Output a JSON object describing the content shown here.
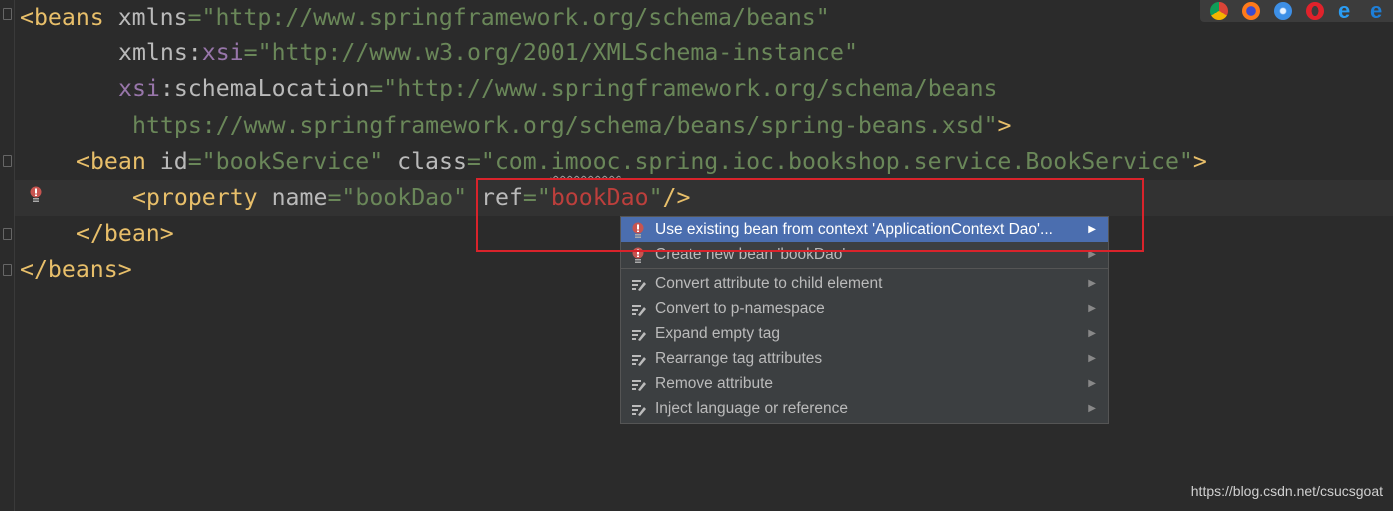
{
  "editor": {
    "lines": [
      {
        "parts": [
          "<beans",
          " xmlns",
          "=",
          "\"http://www.springframework.org/schema/beans\""
        ]
      },
      {
        "parts": [
          "xmlns:",
          "xsi",
          "=",
          "\"http://www.w3.org/2001/XMLSchema-instance\""
        ]
      },
      {
        "parts": [
          "xsi",
          ":schemaLocation",
          "=",
          "\"http://www.springframework.org/schema/beans"
        ]
      },
      {
        "parts": [
          "https://www.springframework.org/schema/beans/spring-beans.xsd\"",
          ">"
        ]
      },
      {
        "parts": [
          "<bean",
          " id",
          "=",
          "\"bookService\"",
          " class",
          "=",
          "\"com.",
          "imooc",
          ".spring.ioc.bookshop.service.BookService\"",
          ">"
        ]
      },
      {
        "parts": [
          "<property",
          " name",
          "=",
          "\"bookDao\"",
          " ref",
          "=",
          "\"",
          "bookDao",
          "\"",
          "/>"
        ]
      },
      {
        "parts": [
          "</bean>"
        ]
      },
      {
        "parts": [
          "</beans>"
        ]
      }
    ]
  },
  "popup": {
    "items": [
      {
        "label": "Use existing bean from context 'ApplicationContext Dao'...",
        "icon": "error-bulb-icon",
        "selected": true
      },
      {
        "label": "Create new bean 'bookDao'",
        "icon": "error-bulb-icon"
      },
      {
        "label": "Convert attribute to child element",
        "icon": "intention-icon"
      },
      {
        "label": "Convert to p-namespace",
        "icon": "intention-icon"
      },
      {
        "label": "Expand empty tag",
        "icon": "intention-icon"
      },
      {
        "label": "Rearrange tag attributes",
        "icon": "intention-icon"
      },
      {
        "label": "Remove attribute",
        "icon": "intention-icon"
      },
      {
        "label": "Inject language or reference",
        "icon": "intention-icon"
      }
    ]
  },
  "browsers": [
    "chrome",
    "firefox",
    "safari",
    "opera",
    "ie",
    "edge"
  ],
  "watermark": "https://blog.csdn.net/csucsgoat",
  "colors": {
    "background": "#2b2b2b",
    "tag": "#e8bf6a",
    "string": "#6a8759",
    "error": "#bc3f3c",
    "selection": "#4b6eaf",
    "highlight_box": "#d9232b"
  }
}
